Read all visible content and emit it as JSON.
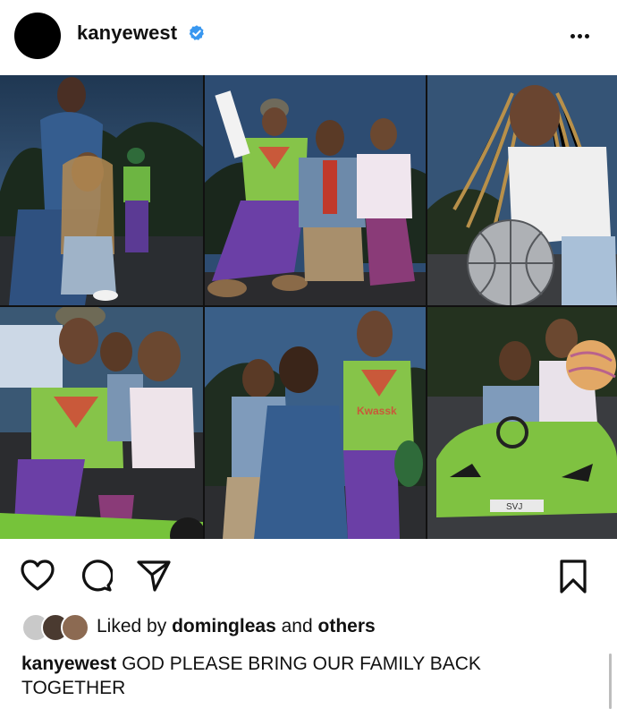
{
  "post": {
    "username": "kanyewest",
    "verified": true,
    "more_icon": "more-horizontal-icon",
    "photo_tiles": [
      "photo-mother-with-children",
      "photo-three-children-sitting",
      "photo-girl-with-basketball",
      "photo-children-on-toy-quad",
      "photo-mother-kissing-child",
      "photo-children-in-toy-car"
    ],
    "car_plate": "SVJ",
    "shirt_text": "Kwassk"
  },
  "actions": {
    "like_icon": "heart-icon",
    "comment_icon": "comment-icon",
    "share_icon": "send-icon",
    "save_icon": "bookmark-icon"
  },
  "likes": {
    "prefix": "Liked by",
    "user": "domingleas",
    "joiner": "and",
    "others": "others"
  },
  "caption": {
    "username": "kanyewest",
    "text": "GOD PLEASE BRING OUR FAMILY BACK TOGETHER"
  },
  "colors": {
    "verified_blue": "#3897f0",
    "sky_blue": "#3c6088",
    "lime_green": "#7fc241",
    "purple_pants": "#6b3fa6"
  }
}
